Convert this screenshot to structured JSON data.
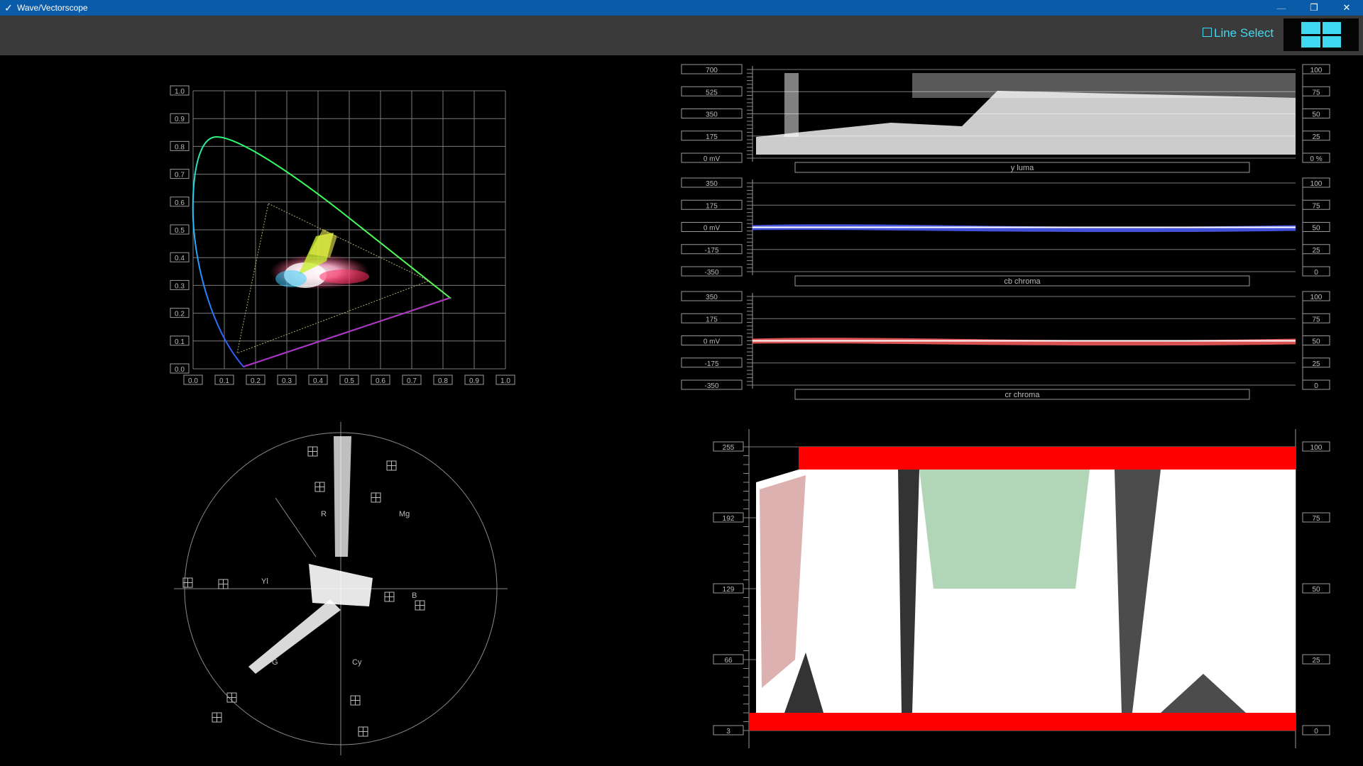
{
  "window": {
    "title": "Wave/Vectorscope",
    "icon": "check-icon"
  },
  "titlebar_buttons": [
    {
      "name": "minimize-button",
      "glyph": "—"
    },
    {
      "name": "restore-button",
      "glyph": "❐"
    },
    {
      "name": "close-button",
      "glyph": "✕"
    }
  ],
  "toolbar": {
    "line_select_label": "Line Select",
    "line_select_checked": false,
    "layout_icon": "quad-layout-icon",
    "accent_color": "#3fd8f0"
  },
  "cie": {
    "x_ticks": [
      "0.0",
      "0.1",
      "0.2",
      "0.3",
      "0.4",
      "0.5",
      "0.6",
      "0.7",
      "0.8",
      "0.9",
      "1.0"
    ],
    "y_ticks": [
      "0.0",
      "0.1",
      "0.2",
      "0.3",
      "0.4",
      "0.5",
      "0.6",
      "0.7",
      "0.8",
      "0.9",
      "1.0"
    ]
  },
  "vectorscope": {
    "targets": [
      "R",
      "Mg",
      "B",
      "Cy",
      "G",
      "Yl"
    ]
  },
  "waveform": {
    "y_luma": {
      "label": "y luma",
      "left_ticks": [
        "700",
        "525",
        "350",
        "175",
        "0 mV"
      ],
      "right_ticks": [
        "100",
        "75",
        "50",
        "25",
        "0 %"
      ]
    },
    "cb": {
      "label": "cb chroma",
      "left_ticks": [
        "350",
        "175",
        "0 mV",
        "-175",
        "-350"
      ],
      "right_ticks": [
        "100",
        "75",
        "50",
        "25",
        "0"
      ]
    },
    "cr": {
      "label": "cr chroma",
      "left_ticks": [
        "350",
        "175",
        "0 mV",
        "-175",
        "-350"
      ],
      "right_ticks": [
        "100",
        "75",
        "50",
        "25",
        "0"
      ]
    }
  },
  "rgb_parade": {
    "left_ticks": [
      "255",
      "192",
      "129",
      "66",
      "3"
    ],
    "right_ticks": [
      "100",
      "75",
      "50",
      "25",
      "0"
    ]
  },
  "colors": {
    "titlebar": "#0a5ca8",
    "toolbar": "#3a3a3a",
    "scope_grid": "#9a9a9a",
    "clip_red": "#ff0000"
  }
}
